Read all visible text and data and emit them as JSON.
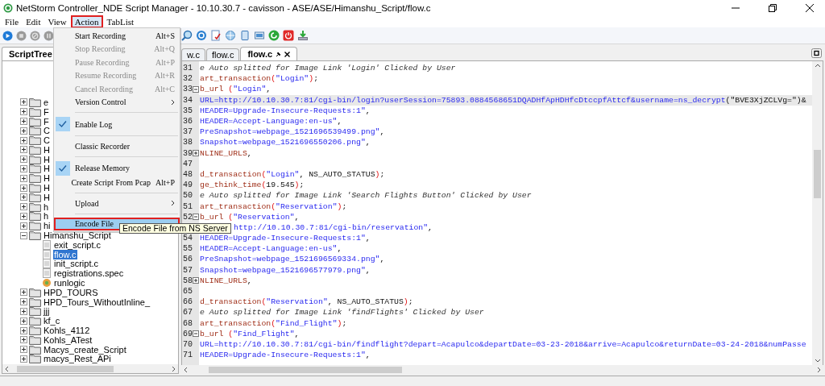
{
  "window": {
    "title": "NetStorm Controller_NDE Script Manager - 10.10.30.7 - cavisson - ASE/ASE/Himanshu_Script/flow.c"
  },
  "menubar": [
    {
      "label": "File",
      "selected": false
    },
    {
      "label": "Edit",
      "selected": false
    },
    {
      "label": "View",
      "selected": false
    },
    {
      "label": "Action",
      "selected": true
    },
    {
      "label": "TabList",
      "selected": false
    }
  ],
  "action_menu": [
    {
      "kind": "item",
      "label": "Start Recording",
      "shortcut": "Alt+S",
      "disabled": false
    },
    {
      "kind": "item",
      "label": "Stop Recording",
      "shortcut": "Alt+Q",
      "disabled": true
    },
    {
      "kind": "item",
      "label": "Pause Recording",
      "shortcut": "Alt+P",
      "disabled": true
    },
    {
      "kind": "item",
      "label": "Resume Recording",
      "shortcut": "Alt+R",
      "disabled": true
    },
    {
      "kind": "item",
      "label": "Cancel Recording",
      "shortcut": "Alt+C",
      "disabled": true
    },
    {
      "kind": "submenu",
      "label": "Version Control"
    },
    {
      "kind": "separator"
    },
    {
      "kind": "check",
      "label": "Enable Log",
      "checked": true
    },
    {
      "kind": "separator"
    },
    {
      "kind": "item",
      "label": "Classic Recorder",
      "disabled": false
    },
    {
      "kind": "separator"
    },
    {
      "kind": "check",
      "label": "Release Memory",
      "checked": true
    },
    {
      "kind": "item",
      "label": "Create Script From Pcap",
      "shortcut": "Alt+P",
      "disabled": false
    },
    {
      "kind": "separator"
    },
    {
      "kind": "submenu",
      "label": "Upload"
    },
    {
      "kind": "separator"
    },
    {
      "kind": "item",
      "label": "Encode File",
      "disabled": false,
      "highlighted": true
    }
  ],
  "tooltip": "Encode File from NS Server",
  "left_panel": {
    "tab": {
      "label": "ScriptTree",
      "selected": true
    },
    "tree": [
      {
        "kind": "folder",
        "label": "e",
        "expanded": false,
        "selected": false
      },
      {
        "kind": "folder",
        "label": "F",
        "expanded": false,
        "selected": false
      },
      {
        "kind": "folder",
        "label": "F",
        "expanded": false,
        "selected": false
      },
      {
        "kind": "folder",
        "label": "C",
        "expanded": false,
        "selected": false
      },
      {
        "kind": "folder",
        "label": "C",
        "expanded": false,
        "selected": false
      },
      {
        "kind": "folder",
        "label": "H",
        "expanded": false,
        "selected": false
      },
      {
        "kind": "folder",
        "label": "H",
        "expanded": false,
        "selected": false
      },
      {
        "kind": "folder",
        "label": "H",
        "expanded": false,
        "selected": false
      },
      {
        "kind": "folder",
        "label": "H",
        "expanded": false,
        "selected": false
      },
      {
        "kind": "folder",
        "label": "H",
        "expanded": false,
        "selected": false
      },
      {
        "kind": "folder",
        "label": "H",
        "expanded": false,
        "selected": false
      },
      {
        "kind": "folder",
        "label": "h",
        "expanded": false,
        "selected": false
      },
      {
        "kind": "folder",
        "label": "h",
        "expanded": false,
        "selected": false
      },
      {
        "kind": "folder",
        "label": "hi",
        "expanded": false,
        "selected": false
      },
      {
        "kind": "folder",
        "label": "Himanshu_Script",
        "expanded": true,
        "selected": false,
        "children": [
          {
            "kind": "file",
            "label": "exit_script.c",
            "selected": false
          },
          {
            "kind": "file",
            "label": "flow.c",
            "selected": true
          },
          {
            "kind": "file",
            "label": "init_script.c",
            "selected": false
          },
          {
            "kind": "file",
            "label": "registrations.spec",
            "selected": false
          },
          {
            "kind": "logic",
            "label": "runlogic",
            "selected": false
          }
        ]
      },
      {
        "kind": "folder",
        "label": "HPD_TOURS",
        "expanded": false,
        "selected": false
      },
      {
        "kind": "folder",
        "label": "HPD_Tours_WithoutInline_",
        "expanded": false,
        "selected": false
      },
      {
        "kind": "folder",
        "label": "jjj",
        "expanded": false,
        "selected": false
      },
      {
        "kind": "folder",
        "label": "kf_c",
        "expanded": false,
        "selected": false
      },
      {
        "kind": "folder",
        "label": "Kohls_4112",
        "expanded": false,
        "selected": false
      },
      {
        "kind": "folder",
        "label": "Kohls_ATest",
        "expanded": false,
        "selected": false
      },
      {
        "kind": "folder",
        "label": "Macys_create_Script",
        "expanded": false,
        "selected": false
      },
      {
        "kind": "folder",
        "label": "macys_Rest_APi",
        "expanded": false,
        "selected": false
      }
    ]
  },
  "editor": {
    "tabs": [
      {
        "label": "w.c",
        "selected": false,
        "closable": false
      },
      {
        "label": "flow.c",
        "selected": false,
        "closable": false
      },
      {
        "label": "flow.c",
        "selected": true,
        "closable": true
      }
    ],
    "lines": [
      {
        "number": "31",
        "segments": [
          {
            "kind": "comment",
            "text": "e Auto splitted for Image Link 'Login' Clicked by User"
          }
        ]
      },
      {
        "number": "32",
        "segments": [
          {
            "kind": "function",
            "text": "art_transaction"
          },
          {
            "kind": "paren",
            "text": "("
          },
          {
            "kind": "string",
            "text": "\"Login\""
          },
          {
            "kind": "paren",
            "text": ")"
          },
          {
            "kind": "text",
            "text": ";"
          }
        ]
      },
      {
        "number": "33",
        "collapsed": false,
        "segments": [
          {
            "kind": "function",
            "text": "b_url"
          },
          {
            "kind": "paren",
            "text": " ("
          },
          {
            "kind": "string",
            "text": "\"Login\""
          },
          {
            "kind": "text",
            "text": ","
          }
        ]
      },
      {
        "number": "34",
        "highlighted": true,
        "segments": [
          {
            "kind": "string",
            "text": "URL=http://10.10.30.7:81/cgi-bin/login?userSession=75893.0884568651DQADHfApHDHfcDtccpfAttcf&username=ns_decrypt"
          },
          {
            "kind": "text",
            "text": "(\"BVE3XjZCLVg=\")&"
          }
        ]
      },
      {
        "number": "35",
        "segments": [
          {
            "kind": "string",
            "text": "HEADER=Upgrade-Insecure-Requests:1\""
          },
          {
            "kind": "text",
            "text": ","
          }
        ]
      },
      {
        "number": "36",
        "segments": [
          {
            "kind": "string",
            "text": "HEADER=Accept-Language:en-us\""
          },
          {
            "kind": "text",
            "text": ","
          }
        ]
      },
      {
        "number": "37",
        "segments": [
          {
            "kind": "string",
            "text": "PreSnapshot=webpage_1521696539499.png\""
          },
          {
            "kind": "text",
            "text": ","
          }
        ]
      },
      {
        "number": "38",
        "segments": [
          {
            "kind": "string",
            "text": "Snapshot=webpage_1521696550206.png\""
          },
          {
            "kind": "text",
            "text": ","
          }
        ]
      },
      {
        "number": "39",
        "collapsed": true,
        "segments": [
          {
            "kind": "function",
            "text": "NLINE_URLS"
          },
          {
            "kind": "text",
            "text": ","
          }
        ]
      },
      {
        "number": "47"
      },
      {
        "number": "48",
        "segments": [
          {
            "kind": "function",
            "text": "d_transaction"
          },
          {
            "kind": "paren",
            "text": "("
          },
          {
            "kind": "string",
            "text": "\"Login\""
          },
          {
            "kind": "text",
            "text": ", NS_AUTO_STATUS"
          },
          {
            "kind": "paren",
            "text": ")"
          },
          {
            "kind": "text",
            "text": ";"
          }
        ]
      },
      {
        "number": "49",
        "segments": [
          {
            "kind": "function",
            "text": "ge_think_time"
          },
          {
            "kind": "paren",
            "text": "("
          },
          {
            "kind": "text",
            "text": "19.545"
          },
          {
            "kind": "paren",
            "text": ")"
          },
          {
            "kind": "text",
            "text": ";"
          }
        ]
      },
      {
        "number": "50",
        "segments": [
          {
            "kind": "comment",
            "text": "e Auto splitted for Image Link 'Search Flights Button' Clicked by User"
          }
        ]
      },
      {
        "number": "51",
        "segments": [
          {
            "kind": "function",
            "text": "art_transaction"
          },
          {
            "kind": "paren",
            "text": "("
          },
          {
            "kind": "string",
            "text": "\"Reservation\""
          },
          {
            "kind": "paren",
            "text": ")"
          },
          {
            "kind": "text",
            "text": ";"
          }
        ]
      },
      {
        "number": "52",
        "collapsed": false,
        "segments": [
          {
            "kind": "function",
            "text": "b_url"
          },
          {
            "kind": "paren",
            "text": " ("
          },
          {
            "kind": "string",
            "text": "\"Reservation\""
          },
          {
            "kind": "text",
            "text": ","
          }
        ]
      },
      {
        "covered": true,
        "segments": [
          {
            "kind": "string",
            "text": "http://10.10.30.7:81/cgi-bin/reservation\""
          },
          {
            "kind": "text",
            "text": ","
          }
        ]
      },
      {
        "number": "54",
        "segments": [
          {
            "kind": "string",
            "text": "HEADER=Upgrade-Insecure-Requests:1\""
          },
          {
            "kind": "text",
            "text": ","
          }
        ]
      },
      {
        "number": "55",
        "segments": [
          {
            "kind": "string",
            "text": "HEADER=Accept-Language:en-us\""
          },
          {
            "kind": "text",
            "text": ","
          }
        ]
      },
      {
        "number": "56",
        "segments": [
          {
            "kind": "string",
            "text": "PreSnapshot=webpage_1521696569334.png\""
          },
          {
            "kind": "text",
            "text": ","
          }
        ]
      },
      {
        "number": "57",
        "segments": [
          {
            "kind": "string",
            "text": "Snapshot=webpage_1521696577979.png\""
          },
          {
            "kind": "text",
            "text": ","
          }
        ]
      },
      {
        "number": "58",
        "collapsed": true,
        "segments": [
          {
            "kind": "function",
            "text": "NLINE_URLS"
          },
          {
            "kind": "text",
            "text": ","
          }
        ]
      },
      {
        "number": "65"
      },
      {
        "number": "66",
        "segments": [
          {
            "kind": "function",
            "text": "d_transaction"
          },
          {
            "kind": "paren",
            "text": "("
          },
          {
            "kind": "string",
            "text": "\"Reservation\""
          },
          {
            "kind": "text",
            "text": ", NS_AUTO_STATUS"
          },
          {
            "kind": "paren",
            "text": ")"
          },
          {
            "kind": "text",
            "text": ";"
          }
        ]
      },
      {
        "number": "67",
        "segments": [
          {
            "kind": "comment",
            "text": "e Auto splitted for Image Link 'findFlights' Clicked by User"
          }
        ]
      },
      {
        "number": "68",
        "segments": [
          {
            "kind": "function",
            "text": "art_transaction"
          },
          {
            "kind": "paren",
            "text": "("
          },
          {
            "kind": "string",
            "text": "\"Find_Flight\""
          },
          {
            "kind": "paren",
            "text": ")"
          },
          {
            "kind": "text",
            "text": ";"
          }
        ]
      },
      {
        "number": "69",
        "collapsed": false,
        "segments": [
          {
            "kind": "function",
            "text": "b_url"
          },
          {
            "kind": "paren",
            "text": " ("
          },
          {
            "kind": "string",
            "text": "\"Find_Flight\""
          },
          {
            "kind": "text",
            "text": ","
          }
        ]
      },
      {
        "number": "70",
        "segments": [
          {
            "kind": "string",
            "text": "URL=http://10.10.30.7:81/cgi-bin/findflight?depart=Acapulco&departDate=03-23-2018&arrive=Acapulco&returnDate=03-24-2018&numPasse"
          }
        ]
      },
      {
        "number": "71",
        "segments": [
          {
            "kind": "string",
            "text": "HEADER=Upgrade-Insecure-Requests:1\""
          },
          {
            "kind": "text",
            "text": ","
          }
        ]
      }
    ]
  }
}
